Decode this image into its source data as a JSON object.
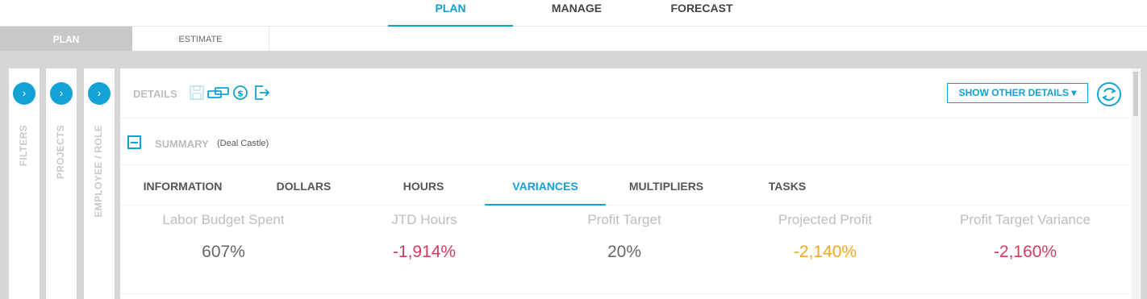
{
  "top_nav": {
    "tabs": [
      {
        "label": "PLAN",
        "active": true
      },
      {
        "label": "MANAGE",
        "active": false
      },
      {
        "label": "FORECAST",
        "active": false
      }
    ]
  },
  "sub_nav": {
    "tabs": [
      {
        "label": "PLAN",
        "active": true
      },
      {
        "label": "ESTIMATE",
        "active": false
      }
    ]
  },
  "side_panels": [
    {
      "label": "FILTERS",
      "toggle": "›"
    },
    {
      "label": "PROJECTS",
      "toggle": "›"
    },
    {
      "label": "EMPLOYEE / ROLE",
      "toggle": "›"
    }
  ],
  "details": {
    "label": "DETAILS",
    "icons": [
      "save-icon",
      "link-icon",
      "dollar-icon",
      "export-icon"
    ],
    "show_other_details": "SHOW OTHER DETAILS ▾",
    "refresh_icon": "refresh-icon"
  },
  "summary": {
    "title": "SUMMARY",
    "subtitle": "(Deal Castle)"
  },
  "detail_tabs": [
    {
      "label": "INFORMATION",
      "active": false
    },
    {
      "label": "DOLLARS",
      "active": false
    },
    {
      "label": "HOURS",
      "active": false
    },
    {
      "label": "VARIANCES",
      "active": true
    },
    {
      "label": "MULTIPLIERS",
      "active": false
    },
    {
      "label": "TASKS",
      "active": false
    }
  ],
  "metrics": [
    {
      "label": "Labor Budget Spent",
      "value": "607%",
      "color": "#666666"
    },
    {
      "label": "JTD Hours",
      "value": "-1,914%",
      "color": "#d13c5f"
    },
    {
      "label": "Profit Target",
      "value": "20%",
      "color": "#666666"
    },
    {
      "label": "Projected Profit",
      "value": "-2,140%",
      "color": "#f5a623"
    },
    {
      "label": "Profit Target Variance",
      "value": "-2,160%",
      "color": "#d13c5f"
    }
  ],
  "colors": {
    "accent": "#13a1d6",
    "negative": "#d13c5f",
    "warning": "#f5a623",
    "muted": "#bdbdbd"
  }
}
